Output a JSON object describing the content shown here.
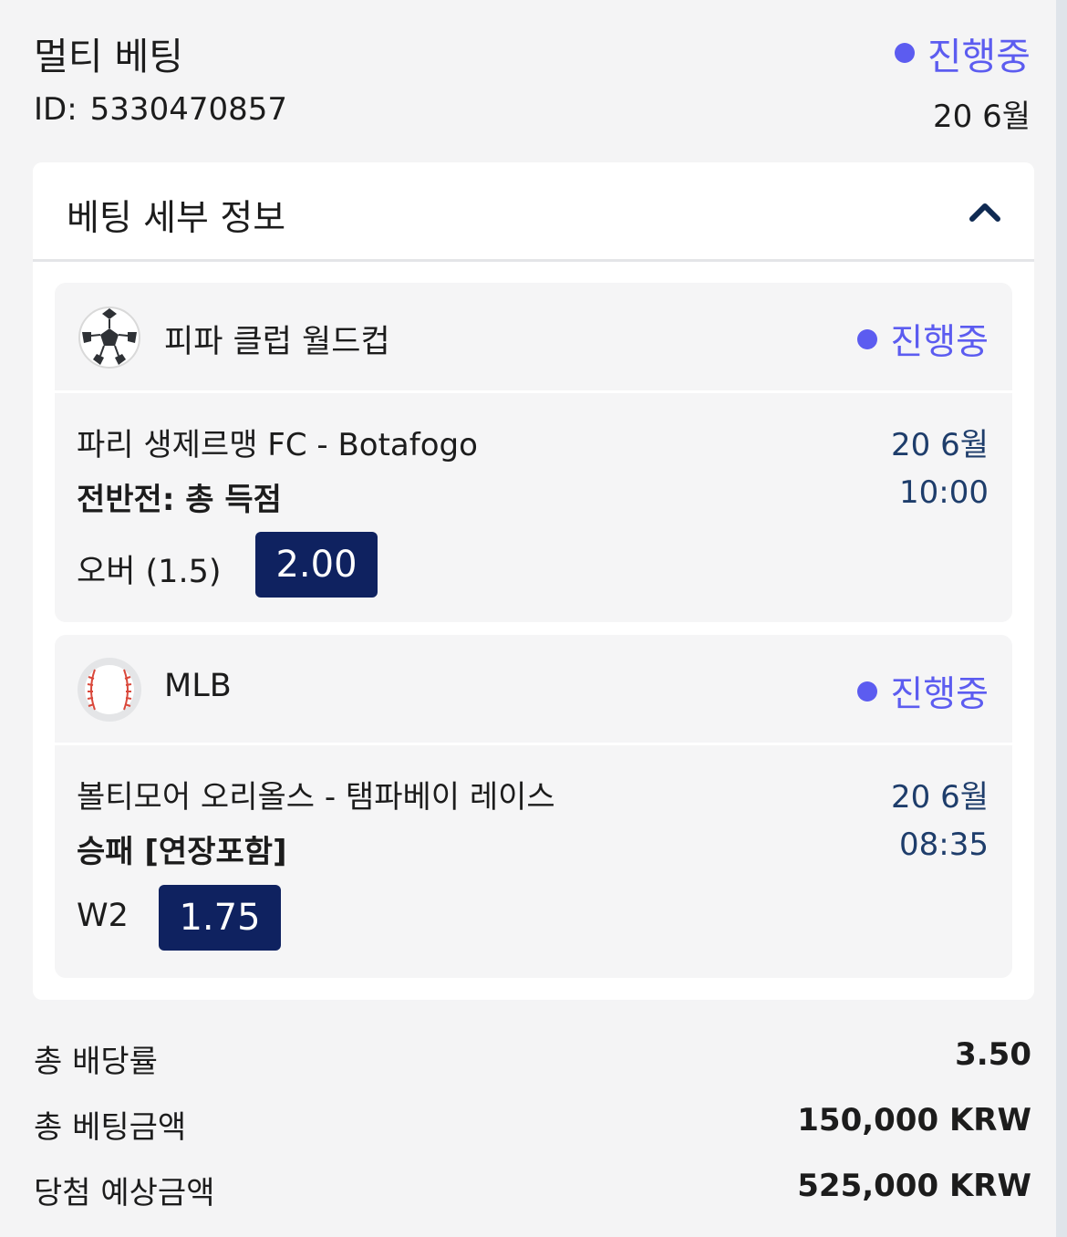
{
  "header": {
    "title": "멀티 베팅",
    "status": "진행중",
    "id_label": "ID:",
    "id_value": "5330470857",
    "date": "20 6월"
  },
  "details": {
    "title": "베팅 세부 정보",
    "collapse_icon": "chevron-up-icon"
  },
  "selections": [
    {
      "sport_icon": "soccer-ball-icon",
      "league": "피파 클럽 월드컵",
      "status": "진행중",
      "match": "파리 생제르맹 FC - Botafogo",
      "date": "20 6월",
      "market": "전반전: 총 득점",
      "time": "10:00",
      "pick": "오버 (1.5)",
      "odds": "2.00"
    },
    {
      "sport_icon": "baseball-icon",
      "league": "MLB",
      "status": "진행중",
      "match": "볼티모어 오리올스 - 탬파베이 레이스",
      "date": "20 6월",
      "market": "승패 [연장포함]",
      "time": "08:35",
      "pick": "W2",
      "odds": "1.75"
    }
  ],
  "summary": [
    {
      "label": "총 배당률",
      "value": "3.50"
    },
    {
      "label": "총 베팅금액",
      "value": "150,000 KRW"
    },
    {
      "label": "당첨 예상금액",
      "value": "525,000 KRW"
    }
  ],
  "colors": {
    "status": "#5c5cf0",
    "odds_bg": "#0f2260",
    "date_text": "#1e3d6b",
    "page_bg": "#f4f4f5"
  }
}
